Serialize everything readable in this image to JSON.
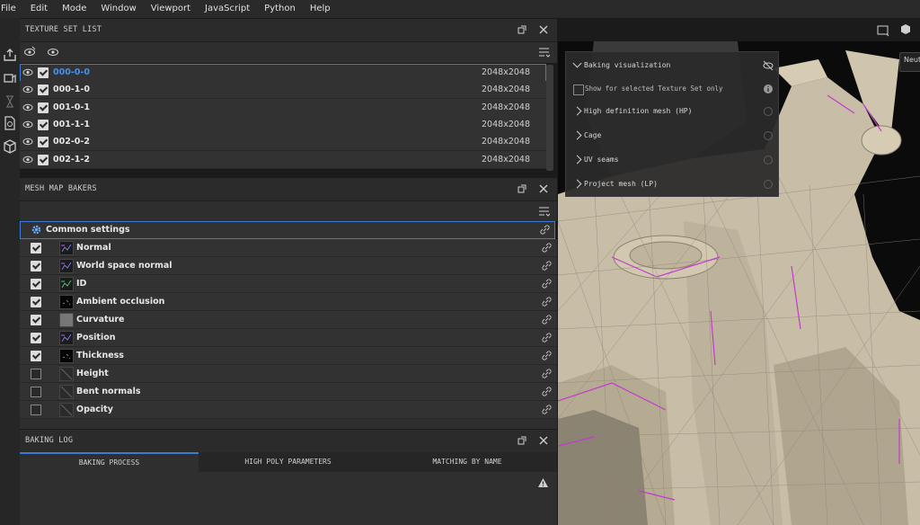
{
  "menu": [
    "File",
    "Edit",
    "Mode",
    "Window",
    "Viewport",
    "JavaScript",
    "Python",
    "Help"
  ],
  "texture_set_list": {
    "title": "TEXTURE SET LIST",
    "rows": [
      {
        "name": "000-0-0",
        "size": "2048x2048",
        "checked": true,
        "selected": true
      },
      {
        "name": "000-1-0",
        "size": "2048x2048",
        "checked": true
      },
      {
        "name": "001-0-1",
        "size": "2048x2048",
        "checked": true
      },
      {
        "name": "001-1-1",
        "size": "2048x2048",
        "checked": true
      },
      {
        "name": "002-0-2",
        "size": "2048x2048",
        "checked": true
      },
      {
        "name": "002-1-2",
        "size": "2048x2048",
        "checked": true
      }
    ]
  },
  "mesh_map_bakers": {
    "title": "MESH MAP BAKERS",
    "common_settings": "Common settings",
    "bakers": [
      {
        "name": "Normal",
        "checked": true,
        "thumb": "normal"
      },
      {
        "name": "World space normal",
        "checked": true,
        "thumb": "normal"
      },
      {
        "name": "ID",
        "checked": true,
        "thumb": "id"
      },
      {
        "name": "Ambient occlusion",
        "checked": true,
        "thumb": "dark"
      },
      {
        "name": "Curvature",
        "checked": true,
        "thumb": "gray"
      },
      {
        "name": "Position",
        "checked": true,
        "thumb": "normal"
      },
      {
        "name": "Thickness",
        "checked": true,
        "thumb": "dark"
      },
      {
        "name": "Height",
        "checked": false,
        "thumb": "empty"
      },
      {
        "name": "Bent normals",
        "checked": false,
        "thumb": "empty"
      },
      {
        "name": "Opacity",
        "checked": false,
        "thumb": "empty"
      }
    ]
  },
  "baking_log": {
    "title": "BAKING LOG",
    "tabs": [
      "BAKING PROCESS",
      "HIGH POLY PARAMETERS",
      "MATCHING BY NAME"
    ],
    "active_tab": 0
  },
  "viewport": {
    "label_right": "Neut",
    "overlay": {
      "title": "Baking visualization",
      "show_selected": "Show for selected Texture Set only",
      "items": [
        "High definition mesh (HP)",
        "Cage",
        "UV seams",
        "Project mesh (LP)"
      ]
    }
  },
  "colors": {
    "accent": "#3d7bd1",
    "selected_text": "#4a8fe8",
    "panel": "#323232",
    "mesh": "#c9bea7",
    "wire": "#c23ad0"
  }
}
